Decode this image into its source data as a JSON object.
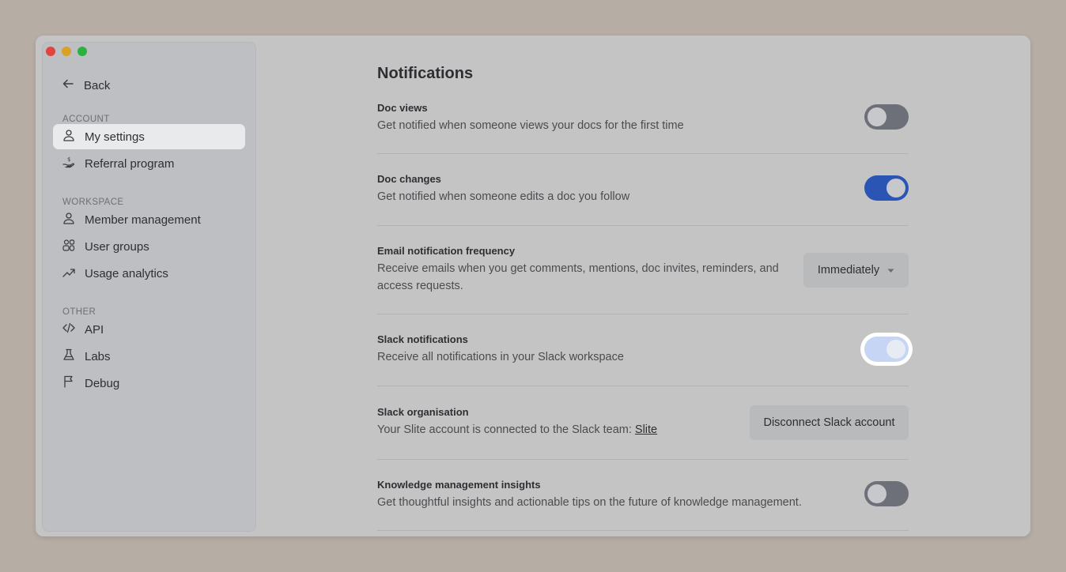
{
  "sidebar": {
    "back_label": "Back",
    "sections": {
      "account": "ACCOUNT",
      "workspace": "WORKSPACE",
      "other": "OTHER"
    },
    "items": {
      "my_settings": "My settings",
      "referral_program": "Referral program",
      "member_management": "Member management",
      "user_groups": "User groups",
      "usage_analytics": "Usage analytics",
      "api": "API",
      "labs": "Labs",
      "debug": "Debug"
    },
    "active_item": "My settings"
  },
  "main": {
    "title": "Notifications",
    "doc_views": {
      "label": "Doc views",
      "description": "Get notified when someone views your docs for the first time",
      "enabled": false
    },
    "doc_changes": {
      "label": "Doc changes",
      "description": "Get notified when someone edits a doc you follow",
      "enabled": true
    },
    "email_frequency": {
      "label": "Email notification frequency",
      "description_line1": "Receive emails when you get comments, mentions, doc invites, reminders, and",
      "description_line2": "access requests.",
      "selected": "Immediately"
    },
    "slack_notifications": {
      "label": "Slack notifications",
      "description": "Receive all notifications in your Slack workspace",
      "enabled": true
    },
    "slack_organisation": {
      "label": "Slack organisation",
      "description": "Your Slite account is connected to the Slack team:",
      "team_link": "Slite",
      "button_label": "Disconnect Slack account"
    },
    "km_insights": {
      "label": "Knowledge management insights",
      "description": "Get thoughtful insights and actionable tips on the future of knowledge management.",
      "enabled": false
    }
  },
  "colors": {
    "toggle_on": "#2b55b4",
    "toggle_off": "#6e7079",
    "toggle_focused": "#c5d5f3",
    "active_nav_bg": "#e9eaec"
  }
}
